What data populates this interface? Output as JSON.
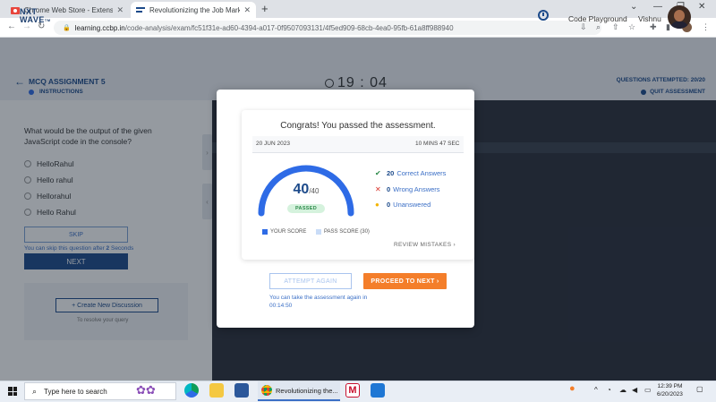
{
  "browser": {
    "tabs": [
      {
        "title": "Chrome Web Store - Extensions",
        "active": false
      },
      {
        "title": "Revolutionizing the Job Market |",
        "active": true
      }
    ],
    "url_host": "learning.ccbp.in",
    "url_path": "/code-analysis/exam/fc51f31e-ad60-4394-a017-0f9507093131/4f5ed909-68cb-4ea0-95fb-61a8ff988940"
  },
  "app": {
    "logo_line1": "NXT",
    "logo_line2": "WAVE",
    "logo_tm": "TM",
    "code_playground": "Code Playground",
    "user_name": "Vishnu"
  },
  "exam": {
    "title": "MCQ ASSIGNMENT 5",
    "instructions": "INSTRUCTIONS",
    "timer": "19 : 04",
    "attempted": "QUESTIONS ATTEMPTED: 20/20",
    "quit": "QUIT ASSESSMENT"
  },
  "question": {
    "text": "What would be the output of the given JavaScript code in the console?",
    "options": [
      "HelloRahul",
      "Hello rahul",
      "Hellorahul",
      "Hello Rahul"
    ],
    "skip_label": "SKIP",
    "skip_note_prefix": "You can skip this question after",
    "skip_note_count": "2",
    "skip_note_suffix": "Seconds",
    "next_label": "NEXT",
    "create_discussion": "+ Create New Discussion",
    "discussion_note": "To resolve your query"
  },
  "result": {
    "heading": "Congrats! You passed the assessment.",
    "date": "20 JUN 2023",
    "duration": "10 MINS 47 SEC",
    "score": "40",
    "score_total": "/40",
    "score_fraction": 1.0,
    "status": "PASSED",
    "stats": [
      {
        "count": "20",
        "label": "Correct Answers",
        "icon": "check-icon",
        "color": "#2c8a4a"
      },
      {
        "count": "0",
        "label": "Wrong Answers",
        "icon": "cross-icon",
        "color": "#d9342b"
      },
      {
        "count": "0",
        "label": "Unanswered",
        "icon": "dot-icon",
        "color": "#f4b400"
      }
    ],
    "legend_your_score": "YOUR SCORE",
    "legend_pass_score": "PASS SCORE (30)",
    "review_mistakes": "REVIEW MISTAKES",
    "attempt_again": "ATTEMPT AGAIN",
    "proceed_next": "PROCEED TO NEXT",
    "retake_note": "You can take the assessment again in 00:14:50"
  },
  "colors": {
    "primary": "#1c4a8a",
    "accent_orange": "#f47e2a",
    "score_arc": "#2e6be6",
    "pass_arc": "#c9dcf7"
  },
  "taskbar": {
    "search_placeholder": "Type here to search",
    "chrome_label": "Revolutionizing the...",
    "time": "12:39 PM",
    "date": "6/20/2023"
  }
}
